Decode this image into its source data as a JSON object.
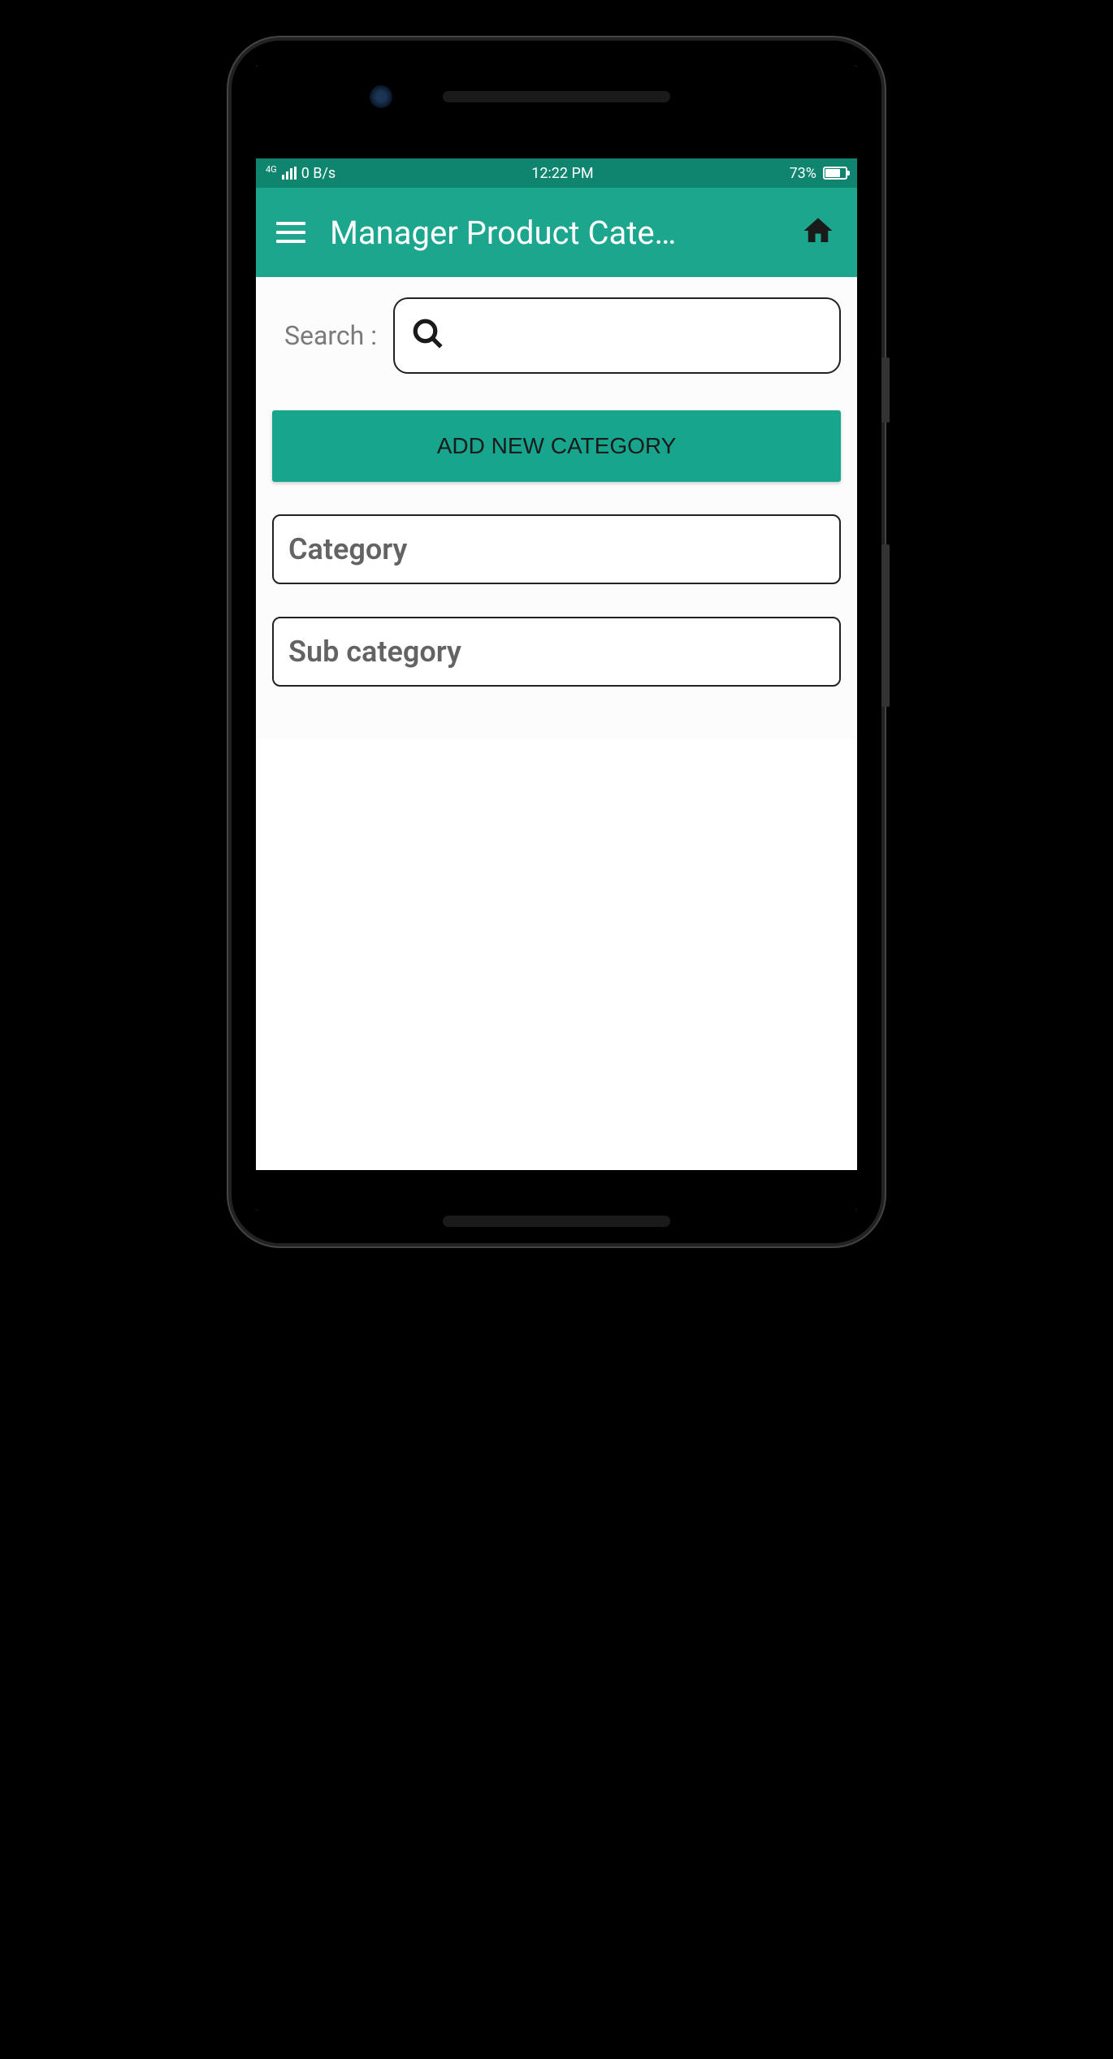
{
  "status": {
    "network_speed": "0 B/s",
    "network_type": "4G",
    "time": "12:22 PM",
    "battery_percent": "73%"
  },
  "header": {
    "title": "Manager Product Cate…"
  },
  "search": {
    "label": "Search :",
    "value": ""
  },
  "buttons": {
    "add_category": "ADD NEW CATEGORY"
  },
  "fields": {
    "category_label": "Category",
    "subcategory_label": "Sub category"
  }
}
